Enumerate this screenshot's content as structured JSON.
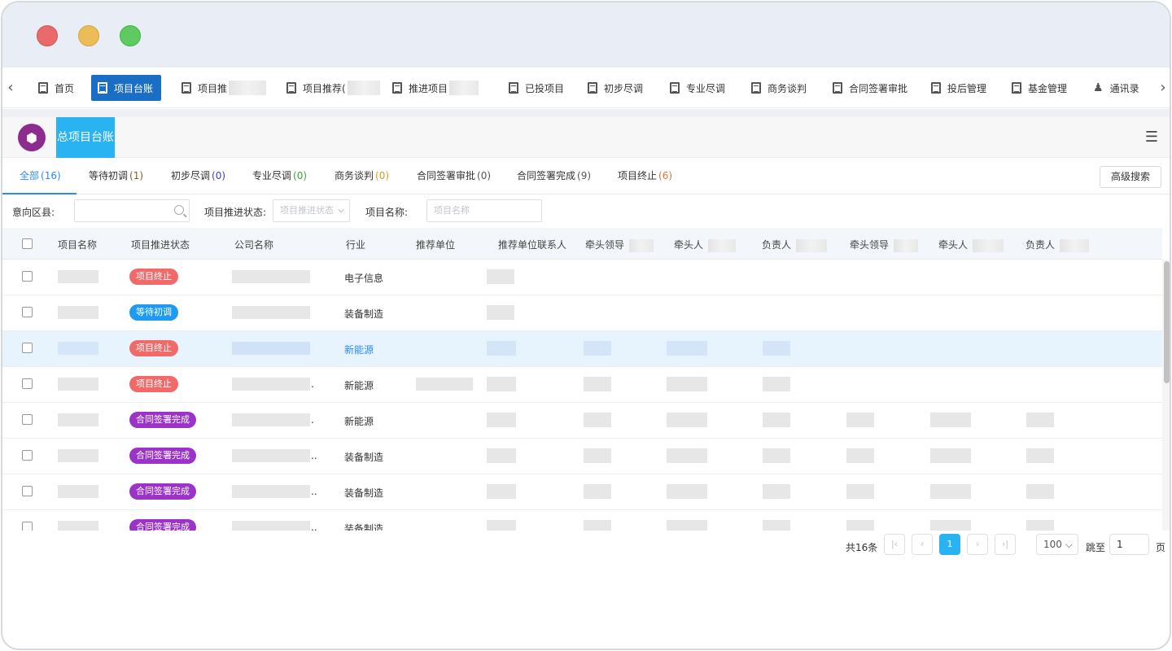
{
  "window": {
    "controls": [
      "close",
      "minimize",
      "maximize"
    ]
  },
  "nav_tabs": [
    {
      "label": "首页",
      "icon": "document-icon",
      "active": false
    },
    {
      "label": "项目台账",
      "icon": "document-icon",
      "active": true
    },
    {
      "label": "项目推",
      "icon": "document-icon",
      "active": false
    },
    {
      "label": "项目推荐(",
      "icon": "document-icon",
      "active": false
    },
    {
      "label": "推进项目",
      "icon": "document-icon",
      "active": false
    },
    {
      "label": "已投项目",
      "icon": "document-icon",
      "active": false
    },
    {
      "label": "初步尽调",
      "icon": "document-icon",
      "active": false
    },
    {
      "label": "专业尽调",
      "icon": "document-icon",
      "active": false
    },
    {
      "label": "商务谈判",
      "icon": "document-icon",
      "active": false
    },
    {
      "label": "合同签署审批",
      "icon": "document-icon",
      "active": false
    },
    {
      "label": "投后管理",
      "icon": "document-icon",
      "active": false
    },
    {
      "label": "基金管理",
      "icon": "document-icon",
      "active": false
    },
    {
      "label": "通讯录",
      "icon": "person-tree-icon",
      "active": false
    }
  ],
  "header": {
    "title": "总项目台账",
    "logo": "cube-icon",
    "menu_icon": "list-menu-icon"
  },
  "status_tabs": [
    {
      "label": "全部",
      "count": "(16)",
      "count_color": "#2d8cf0"
    },
    {
      "label": "等待初调",
      "count": "(1)",
      "count_color": "#8a5a2b"
    },
    {
      "label": "初步尽调",
      "count": "(0)",
      "count_color": "#3b3bd1"
    },
    {
      "label": "专业尽调",
      "count": "(0)",
      "count_color": "#36a836"
    },
    {
      "label": "商务谈判",
      "count": "(0)",
      "count_color": "#d89a1c"
    },
    {
      "label": "合同签署审批",
      "count": "(0)",
      "count_color": "#555555"
    },
    {
      "label": "合同签署完成",
      "count": "(9)",
      "count_color": "#555555"
    },
    {
      "label": "项目终止",
      "count": "(6)",
      "count_color": "#e0733a"
    }
  ],
  "advanced_search_label": "高级搜索",
  "filters": {
    "region_label": "意向区县:",
    "region_value": "",
    "status_label": "项目推进状态:",
    "status_placeholder": "项目推进状态",
    "name_label": "项目名称:",
    "name_placeholder": "项目名称"
  },
  "table": {
    "columns": [
      "项目名称",
      "项目推进状态",
      "公司名称",
      "行业",
      "推荐单位",
      "推荐单位联系人",
      "牵头领导",
      "牵头人",
      "负责人",
      "牵头领导",
      "牵头人",
      "负责人"
    ],
    "rows": [
      {
        "status": "项目终止",
        "status_color": "#f06a6a",
        "company_suffix": "",
        "industry": "电子信息",
        "highlight": false
      },
      {
        "status": "等待初调",
        "status_color": "#1e9bf0",
        "company_suffix": "",
        "industry": "装备制造",
        "highlight": false
      },
      {
        "status": "项目终止",
        "status_color": "#f06a6a",
        "company_suffix": "",
        "industry": "新能源",
        "highlight": true
      },
      {
        "status": "项目终止",
        "status_color": "#f06a6a",
        "company_suffix": ".",
        "industry": "新能源",
        "highlight": false
      },
      {
        "status": "合同签署完成",
        "status_color": "#9c33c9",
        "company_suffix": ".",
        "industry": "新能源",
        "highlight": false
      },
      {
        "status": "合同签署完成",
        "status_color": "#9c33c9",
        "company_suffix": "..",
        "industry": "装备制造",
        "highlight": false
      },
      {
        "status": "合同签署完成",
        "status_color": "#9c33c9",
        "company_suffix": "..",
        "industry": "装备制造",
        "highlight": false
      },
      {
        "status": "合同签署完成",
        "status_color": "#9c33c9",
        "company_suffix": "..",
        "industry": "装备制造",
        "highlight": false
      }
    ]
  },
  "pagination": {
    "total": "共16条",
    "current_page": "1",
    "page_size": "100",
    "jump_label": "跳至",
    "jump_value": "1",
    "page_suffix": "页"
  },
  "colors": {
    "accent": "#2ab3f2",
    "active_tab": "#1a6fc4",
    "logo": "#8e2b8f"
  }
}
